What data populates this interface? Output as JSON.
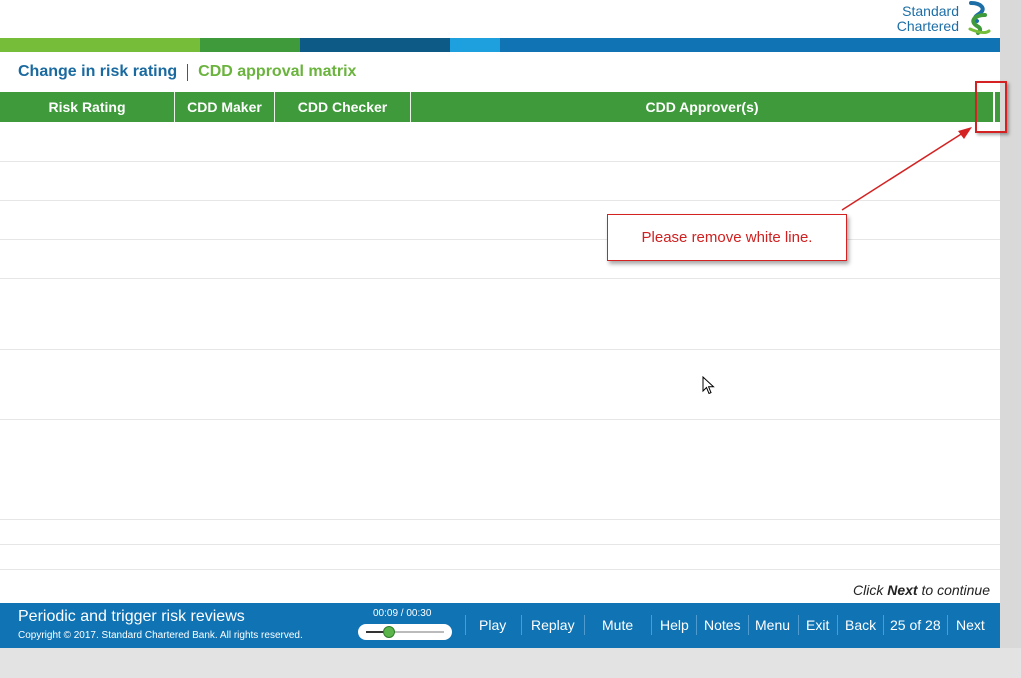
{
  "logo": {
    "line1": "Standard",
    "line2": "Chartered"
  },
  "strip_colors": [
    "#76be3a",
    "#3f9a3c",
    "#0e5a86",
    "#1da0dd",
    "#0f73b4"
  ],
  "breadcrumb": {
    "parent": "Change in risk rating",
    "current": "CDD approval matrix"
  },
  "table": {
    "columns": [
      "Risk Rating",
      "CDD Maker",
      "CDD Checker",
      "CDD Approver(s)"
    ],
    "header_color": "#3f9a3c"
  },
  "annotation": {
    "text": "Please remove white line.",
    "color": "#d42222"
  },
  "continue_hint": {
    "prefix": "Click",
    "action": "Next",
    "suffix": "to continue"
  },
  "footer": {
    "title": "Periodic and trigger risk reviews",
    "copyright": "Copyright © 2017. Standard Chartered Bank. All rights reserved.",
    "time": "00:09 / 00:30",
    "progress": 0.3,
    "buttons": {
      "play": "Play",
      "replay": "Replay",
      "mute": "Mute",
      "help": "Help",
      "notes": "Notes",
      "menu": "Menu",
      "exit": "Exit",
      "back": "Back",
      "page": "25 of 28",
      "next": "Next"
    },
    "color": "#0f73b4"
  }
}
